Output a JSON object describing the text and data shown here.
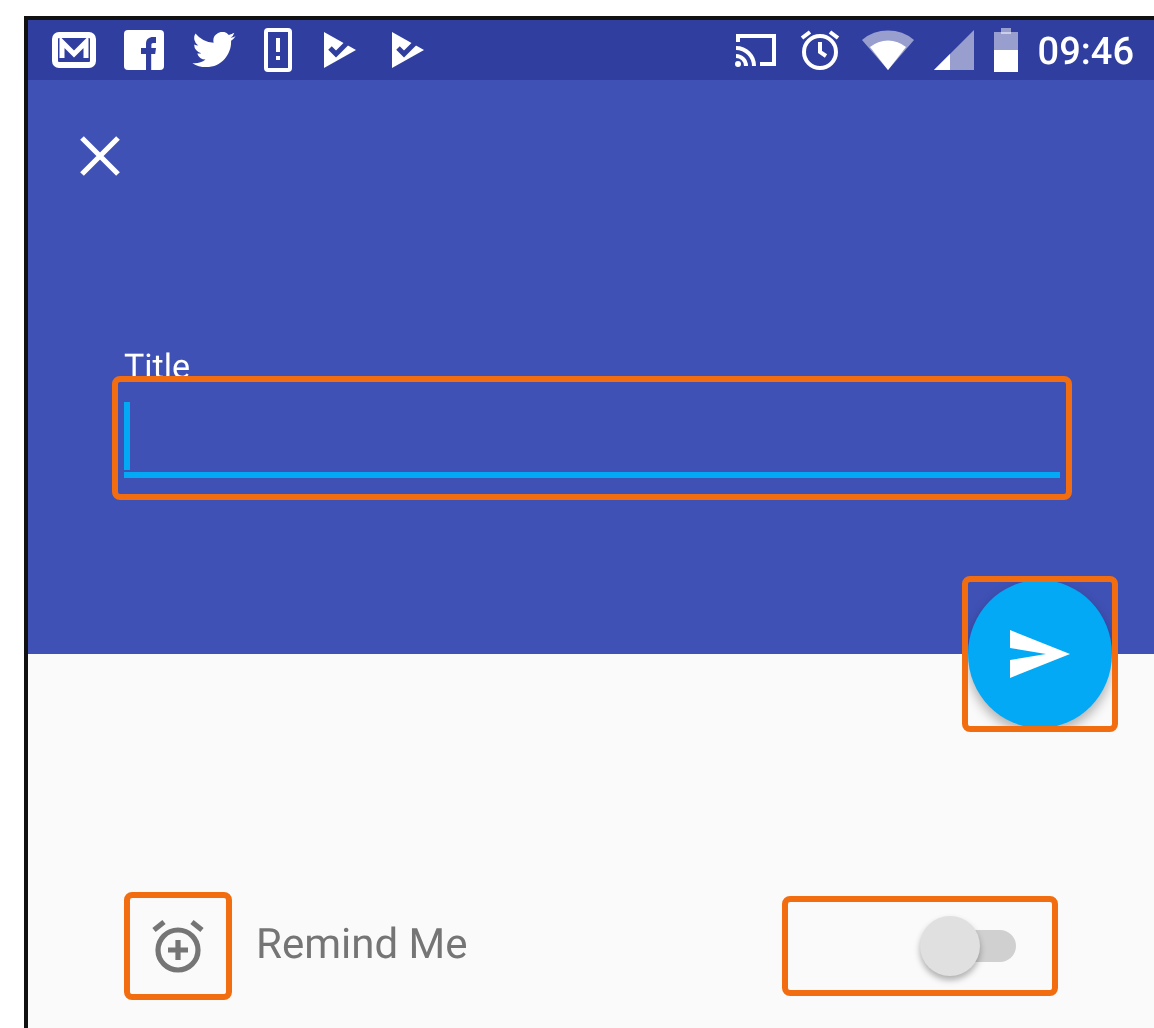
{
  "status_bar": {
    "time": "09:46"
  },
  "title_field": {
    "label": "Title",
    "focused": true
  },
  "reminder": {
    "label": "Remind Me",
    "on": false
  }
}
